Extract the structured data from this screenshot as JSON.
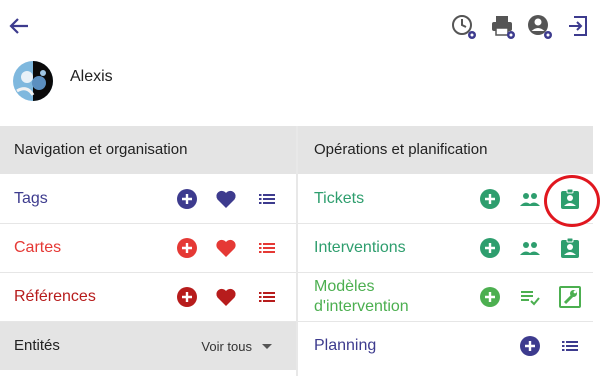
{
  "profile": {
    "name": "Alexis"
  },
  "nav_section": {
    "title": "Navigation et organisation",
    "rows": [
      {
        "label": "Tags",
        "color": "#3d3b8e"
      },
      {
        "label": "Cartes",
        "color": "#e53935"
      },
      {
        "label": "Références",
        "color": "#b71c1c"
      }
    ]
  },
  "entites_section": {
    "title": "Entités",
    "filter_label": "Voir tous"
  },
  "ops_section": {
    "title": "Opérations et planification",
    "rows": [
      {
        "label": "Tickets",
        "color": "#2e9e6e"
      },
      {
        "label": "Interventions",
        "color": "#2e9e6e"
      },
      {
        "label": "Modèles d'intervention",
        "color": "#4caf50"
      },
      {
        "label": "Planning",
        "color": "#3d3b8e"
      }
    ]
  },
  "icons": {
    "toolbar": [
      "back-arrow-icon",
      "history-settings-icon",
      "print-settings-icon",
      "user-settings-icon",
      "logout-icon"
    ],
    "highlight": "red-circle-annotation"
  }
}
